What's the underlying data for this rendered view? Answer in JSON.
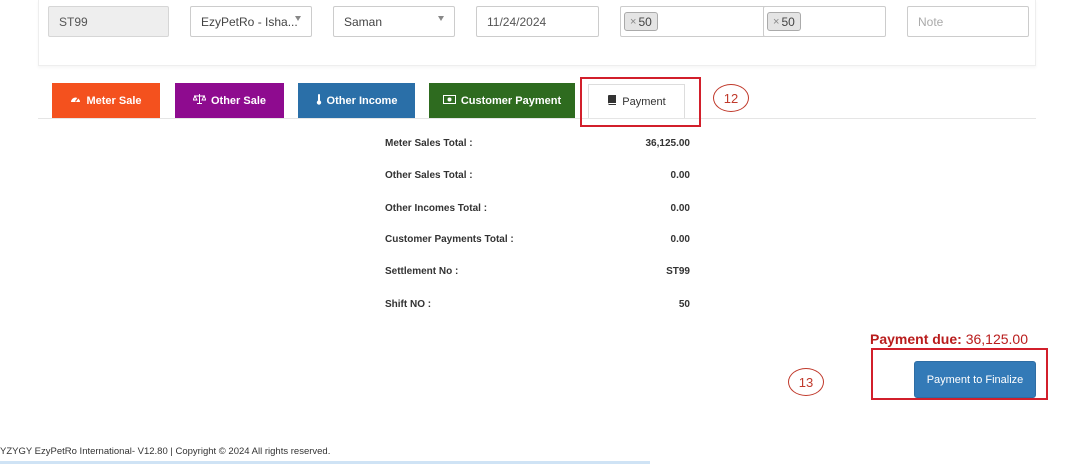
{
  "filters": {
    "settlement_no": "ST99",
    "location": "EzyPetRo - Isha...",
    "pump_operator": "Saman",
    "date": "11/24/2024",
    "shift_chip_1": "50",
    "shift_chip_2": "50",
    "chip_remove_symbol": "×",
    "note_placeholder": "Note"
  },
  "tabs": [
    {
      "label": "Meter Sale",
      "icon": "tachometer-icon",
      "glyph": "🚗",
      "color": "#f4511e"
    },
    {
      "label": "Other Sale",
      "icon": "balance-scale-icon",
      "glyph": "⚖",
      "color": "#8e0b8f"
    },
    {
      "label": "Other Income",
      "icon": "thermometer-icon",
      "glyph": "🌡",
      "color": "#2a6fa8"
    },
    {
      "label": "Customer Payment",
      "icon": "money-icon",
      "glyph": "💵",
      "color": "#2e6b1f"
    },
    {
      "label": "Payment",
      "icon": "book-icon",
      "glyph": "📘",
      "color": "#ffffff"
    }
  ],
  "annotations": {
    "tab_marker": "12",
    "button_marker": "13"
  },
  "summary": [
    {
      "label": "Meter Sales Total :",
      "value": "36,125.00"
    },
    {
      "label": "Other Sales Total :",
      "value": "0.00"
    },
    {
      "label": "Other Incomes Total :",
      "value": "0.00"
    },
    {
      "label": "Customer Payments Total :",
      "value": "0.00"
    },
    {
      "label": "Settlement No :",
      "value": "ST99"
    },
    {
      "label": "Shift NO :",
      "value": "50"
    }
  ],
  "payment_due": {
    "label": "Payment due:",
    "value": "36,125.00"
  },
  "finalize_button": "Payment to Finalize",
  "footer": "YZYGY EzyPetRo International- V12.80 | Copyright © 2024 All rights reserved."
}
